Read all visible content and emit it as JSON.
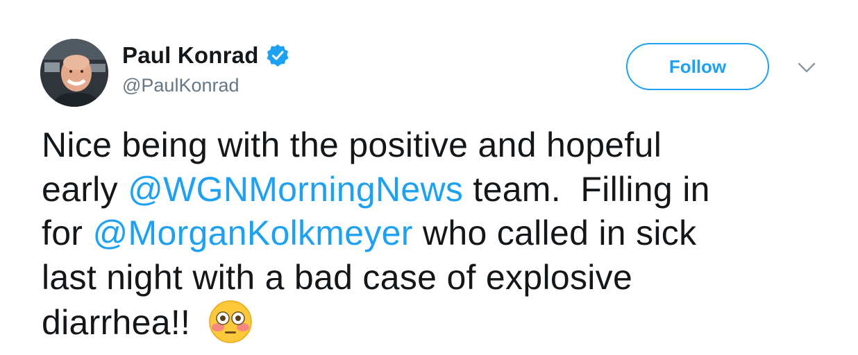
{
  "user": {
    "display_name": "Paul Konrad",
    "handle": "@PaulKonrad",
    "verified": true,
    "avatar_icon": "profile-photo"
  },
  "actions": {
    "follow_label": "Follow",
    "menu_icon": "chevron-down-icon"
  },
  "tweet": {
    "line1": "Nice being with the positive and hopeful",
    "line2_pre": "early ",
    "line2_mention": "@WGNMorningNews",
    "line2_post": " team.  Filling in",
    "line3_pre": "for ",
    "line3_mention": "@MorganKolkmeyer",
    "line3_post": " who called in sick",
    "line4": "last night with a bad case of explosive",
    "line5": "diarrhea!! ",
    "emoji": "flushed-face-emoji"
  },
  "colors": {
    "accent": "#1da1f2",
    "text": "#14171a",
    "secondary": "#657786"
  }
}
